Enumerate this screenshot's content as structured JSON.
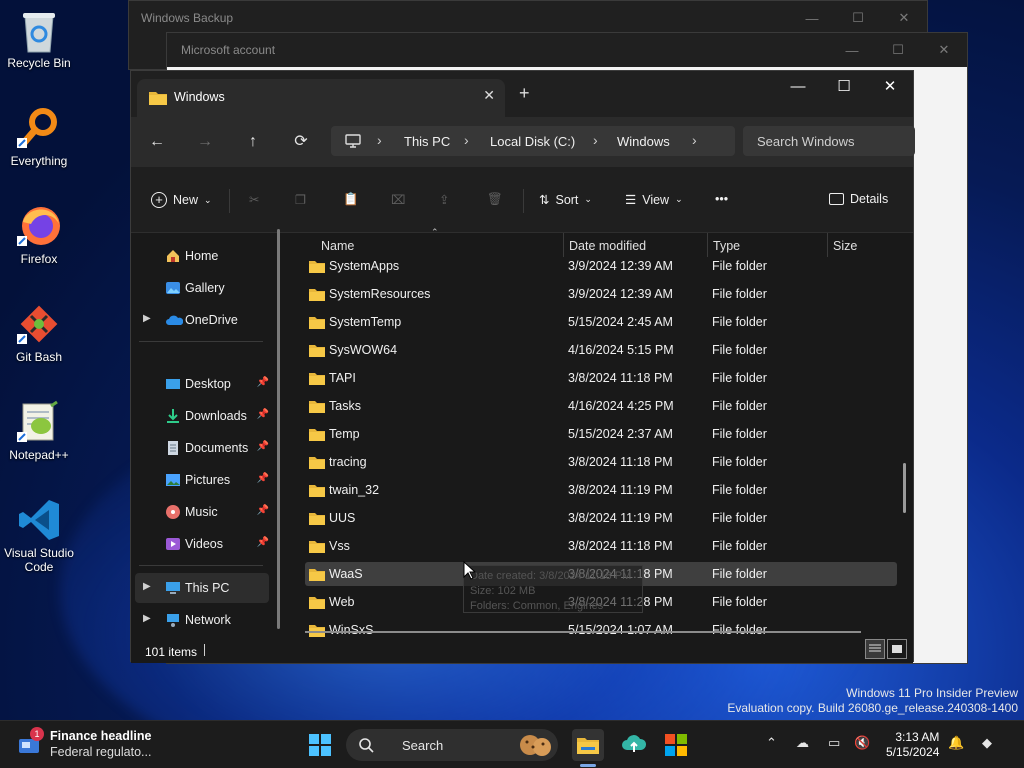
{
  "desktop": {
    "icons": [
      {
        "label": "Recycle Bin",
        "icon": "recycle-bin-icon"
      },
      {
        "label": "Everything",
        "icon": "everything-search-icon"
      },
      {
        "label": "Firefox",
        "icon": "firefox-icon"
      },
      {
        "label": "Git Bash",
        "icon": "git-bash-icon"
      },
      {
        "label": "Notepad++",
        "icon": "notepad-plus-plus-icon"
      },
      {
        "label": "Visual Studio Code",
        "icon": "vscode-icon"
      }
    ],
    "watermark_line1": "Windows 11 Pro Insider Preview",
    "watermark_line2": "Evaluation copy. Build 26080.ge_release.240308-1400"
  },
  "background_windows": {
    "backup_title": "Windows Backup",
    "account_title": "Microsoft account"
  },
  "explorer": {
    "tab_title": "Windows",
    "new_tab": "+",
    "breadcrumb": [
      "This PC",
      "Local Disk (C:)",
      "Windows"
    ],
    "search_placeholder": "Search Windows",
    "toolbar": {
      "new_label": "New",
      "sort_label": "Sort",
      "view_label": "View",
      "more_label": "•••",
      "details_label": "Details"
    },
    "sidebar": {
      "top": [
        {
          "label": "Home",
          "icon": "home-icon"
        },
        {
          "label": "Gallery",
          "icon": "gallery-icon"
        },
        {
          "label": "OneDrive",
          "icon": "onedrive-icon"
        }
      ],
      "quick_access": [
        {
          "label": "Desktop",
          "icon": "desktop-icon"
        },
        {
          "label": "Downloads",
          "icon": "downloads-icon"
        },
        {
          "label": "Documents",
          "icon": "documents-icon"
        },
        {
          "label": "Pictures",
          "icon": "pictures-icon"
        },
        {
          "label": "Music",
          "icon": "music-icon"
        },
        {
          "label": "Videos",
          "icon": "videos-icon"
        }
      ],
      "this_pc": "This PC",
      "network": "Network"
    },
    "columns": {
      "name": "Name",
      "date": "Date modified",
      "type": "Type",
      "size": "Size"
    },
    "files": [
      {
        "name": "SystemApps",
        "date": "3/9/2024 12:39 AM",
        "type": "File folder"
      },
      {
        "name": "SystemResources",
        "date": "3/9/2024 12:39 AM",
        "type": "File folder"
      },
      {
        "name": "SystemTemp",
        "date": "5/15/2024 2:45 AM",
        "type": "File folder"
      },
      {
        "name": "SysWOW64",
        "date": "4/16/2024 5:15 PM",
        "type": "File folder"
      },
      {
        "name": "TAPI",
        "date": "3/8/2024 11:18 PM",
        "type": "File folder"
      },
      {
        "name": "Tasks",
        "date": "4/16/2024 4:25 PM",
        "type": "File folder"
      },
      {
        "name": "Temp",
        "date": "5/15/2024 2:37 AM",
        "type": "File folder"
      },
      {
        "name": "tracing",
        "date": "3/8/2024 11:18 PM",
        "type": "File folder"
      },
      {
        "name": "twain_32",
        "date": "3/8/2024 11:19 PM",
        "type": "File folder"
      },
      {
        "name": "UUS",
        "date": "3/8/2024 11:19 PM",
        "type": "File folder"
      },
      {
        "name": "Vss",
        "date": "3/8/2024 11:18 PM",
        "type": "File folder"
      },
      {
        "name": "WaaS",
        "date": "3/8/2024 11:18 PM",
        "type": "File folder"
      },
      {
        "name": "Web",
        "date": "3/8/2024 11:28 PM",
        "type": "File folder"
      },
      {
        "name": "WinSxS",
        "date": "5/15/2024 1:07 AM",
        "type": "File folder"
      }
    ],
    "selected_index": 11,
    "tooltip": {
      "created": "Date created: 3/8/2024 11:18 PM",
      "size": "Size: 102 MB",
      "folders": "Folders: Common, Engines"
    },
    "status_count": "101 items"
  },
  "taskbar": {
    "news_badge": "1",
    "news_headline": "Finance headline",
    "news_sub": "Federal regulato...",
    "search_label": "Search",
    "clock_time": "3:13 AM",
    "clock_date": "5/15/2024"
  },
  "colors": {
    "folder": "#e8b73a",
    "accent": "#0078d4",
    "selection": "#3f3f3f"
  }
}
